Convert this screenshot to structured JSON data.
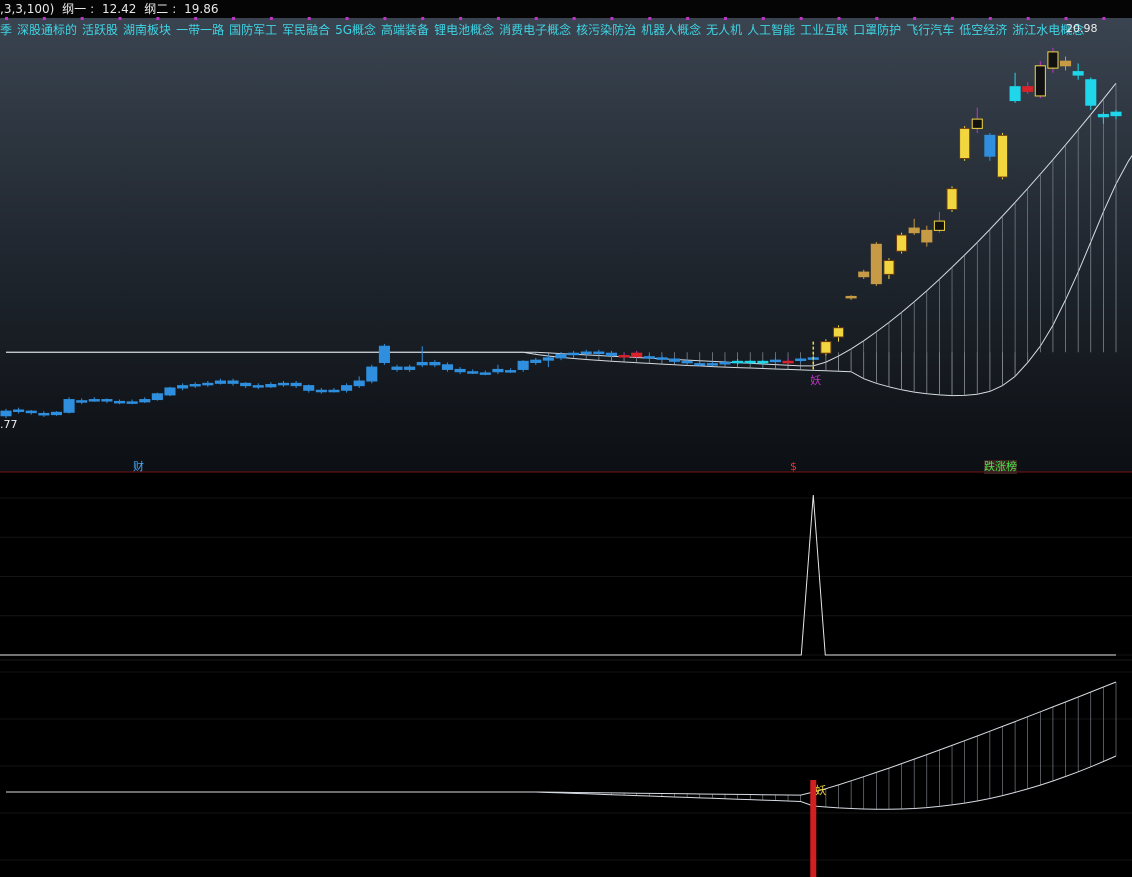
{
  "header": {
    "params": ",3,3,100)",
    "line1_label": "纲一",
    "line1_value": "12.42",
    "line2_label": "纲二",
    "line2_value": "19.86"
  },
  "concepts": [
    "季",
    "深股通标的",
    "活跃股",
    "湖南板块",
    "一带一路",
    "国防军工",
    "军民融合",
    "5G概念",
    "高端装备",
    "锂电池概念",
    "消费电子概念",
    "核污染防治",
    "机器人概念",
    "无人机",
    "人工智能",
    "工业互联",
    "口罩防护",
    "飞行汽车",
    "低空经济",
    "浙江水电概念"
  ],
  "price_labels": {
    "high": "20.98",
    "low": ".77"
  },
  "markers": {
    "cai": "财",
    "dollar": "$",
    "dzb": "跌涨榜"
  },
  "candle_marks": {
    "main_signal": "妖",
    "bottom_signal": "妖"
  },
  "colors": {
    "blue_candle": "#2f8fde",
    "yellow_candle": "#f2d640",
    "tan_candle": "#c79a45",
    "cyan_candle": "#1fd6ea",
    "magenta": "#c233c8",
    "red": "#d8232a",
    "line": "#d6dbe2",
    "signal_bar": "#d21f1f"
  },
  "chart_data": [
    {
      "type": "candlestick",
      "price_high_label": 20.98,
      "candles": [
        {
          "o": 5.1,
          "c": 5.3,
          "h": 5.4,
          "l": 5.0,
          "k": "blue"
        },
        {
          "o": 5.3,
          "c": 5.35,
          "h": 5.45,
          "l": 5.2,
          "k": "blue"
        },
        {
          "o": 5.3,
          "c": 5.25,
          "h": 5.35,
          "l": 5.15,
          "k": "blue"
        },
        {
          "o": 5.2,
          "c": 5.15,
          "h": 5.3,
          "l": 5.05,
          "k": "blue"
        },
        {
          "o": 5.15,
          "c": 5.25,
          "h": 5.3,
          "l": 5.1,
          "k": "blue"
        },
        {
          "o": 5.25,
          "c": 5.8,
          "h": 5.9,
          "l": 5.2,
          "k": "blue"
        },
        {
          "o": 5.7,
          "c": 5.75,
          "h": 5.85,
          "l": 5.6,
          "k": "blue"
        },
        {
          "o": 5.75,
          "c": 5.8,
          "h": 5.9,
          "l": 5.7,
          "k": "blue"
        },
        {
          "o": 5.8,
          "c": 5.75,
          "h": 5.85,
          "l": 5.65,
          "k": "blue"
        },
        {
          "o": 5.7,
          "c": 5.72,
          "h": 5.8,
          "l": 5.6,
          "k": "blue"
        },
        {
          "o": 5.7,
          "c": 5.7,
          "h": 5.8,
          "l": 5.6,
          "k": "blue"
        },
        {
          "o": 5.7,
          "c": 5.8,
          "h": 5.9,
          "l": 5.65,
          "k": "blue"
        },
        {
          "o": 5.8,
          "c": 6.05,
          "h": 6.1,
          "l": 5.75,
          "k": "blue"
        },
        {
          "o": 6.0,
          "c": 6.3,
          "h": 6.35,
          "l": 5.95,
          "k": "blue"
        },
        {
          "o": 6.3,
          "c": 6.4,
          "h": 6.5,
          "l": 6.2,
          "k": "blue"
        },
        {
          "o": 6.4,
          "c": 6.45,
          "h": 6.55,
          "l": 6.3,
          "k": "blue"
        },
        {
          "o": 6.45,
          "c": 6.5,
          "h": 6.6,
          "l": 6.35,
          "k": "blue"
        },
        {
          "o": 6.5,
          "c": 6.6,
          "h": 6.7,
          "l": 6.45,
          "k": "blue"
        },
        {
          "o": 6.6,
          "c": 6.5,
          "h": 6.7,
          "l": 6.4,
          "k": "blue"
        },
        {
          "o": 6.5,
          "c": 6.4,
          "h": 6.55,
          "l": 6.3,
          "k": "blue"
        },
        {
          "o": 6.4,
          "c": 6.35,
          "h": 6.5,
          "l": 6.25,
          "k": "blue"
        },
        {
          "o": 6.35,
          "c": 6.45,
          "h": 6.55,
          "l": 6.3,
          "k": "blue"
        },
        {
          "o": 6.45,
          "c": 6.5,
          "h": 6.6,
          "l": 6.35,
          "k": "blue"
        },
        {
          "o": 6.5,
          "c": 6.4,
          "h": 6.6,
          "l": 6.3,
          "k": "blue"
        },
        {
          "o": 6.4,
          "c": 6.2,
          "h": 6.45,
          "l": 6.1,
          "k": "blue"
        },
        {
          "o": 6.2,
          "c": 6.15,
          "h": 6.3,
          "l": 6.05,
          "k": "blue"
        },
        {
          "o": 6.15,
          "c": 6.2,
          "h": 6.3,
          "l": 6.1,
          "k": "blue"
        },
        {
          "o": 6.2,
          "c": 6.4,
          "h": 6.5,
          "l": 6.1,
          "k": "blue"
        },
        {
          "o": 6.4,
          "c": 6.6,
          "h": 6.8,
          "l": 6.3,
          "k": "blue"
        },
        {
          "o": 6.6,
          "c": 7.2,
          "h": 7.3,
          "l": 6.5,
          "k": "blue"
        },
        {
          "o": 7.4,
          "c": 8.1,
          "h": 8.2,
          "l": 7.3,
          "k": "blue"
        },
        {
          "o": 7.2,
          "c": 7.1,
          "h": 7.3,
          "l": 7.0,
          "k": "blue"
        },
        {
          "o": 7.1,
          "c": 7.2,
          "h": 7.3,
          "l": 7.0,
          "k": "blue"
        },
        {
          "o": 7.3,
          "c": 7.4,
          "h": 8.1,
          "l": 7.2,
          "k": "blue"
        },
        {
          "o": 7.4,
          "c": 7.3,
          "h": 7.5,
          "l": 7.2,
          "k": "blue"
        },
        {
          "o": 7.3,
          "c": 7.1,
          "h": 7.4,
          "l": 7.0,
          "k": "blue"
        },
        {
          "o": 7.1,
          "c": 7.0,
          "h": 7.2,
          "l": 6.9,
          "k": "blue"
        },
        {
          "o": 7.0,
          "c": 6.95,
          "h": 7.1,
          "l": 6.9,
          "k": "blue"
        },
        {
          "o": 6.95,
          "c": 6.9,
          "h": 7.05,
          "l": 6.85,
          "k": "blue"
        },
        {
          "o": 7.0,
          "c": 7.1,
          "h": 7.3,
          "l": 6.9,
          "k": "blue"
        },
        {
          "o": 7.05,
          "c": 7.05,
          "h": 7.15,
          "l": 6.95,
          "k": "blue"
        },
        {
          "o": 7.1,
          "c": 7.45,
          "h": 7.5,
          "l": 7.0,
          "k": "blue"
        },
        {
          "o": 7.4,
          "c": 7.5,
          "h": 7.6,
          "l": 7.3,
          "k": "blue"
        },
        {
          "o": 7.5,
          "c": 7.6,
          "h": 7.7,
          "l": 7.2,
          "k": "blue"
        },
        {
          "o": 7.6,
          "c": 7.75,
          "h": 7.85,
          "l": 7.5,
          "k": "blue"
        },
        {
          "o": 7.75,
          "c": 7.8,
          "h": 7.9,
          "l": 7.65,
          "k": "blue"
        },
        {
          "o": 7.8,
          "c": 7.85,
          "h": 7.95,
          "l": 7.7,
          "k": "blue"
        },
        {
          "o": 7.85,
          "c": 7.8,
          "h": 7.95,
          "l": 7.7,
          "k": "blue"
        },
        {
          "o": 7.8,
          "c": 7.7,
          "h": 7.9,
          "l": 7.6,
          "k": "blue"
        },
        {
          "o": 7.7,
          "c": 7.65,
          "h": 7.8,
          "l": 7.6,
          "k": "red"
        },
        {
          "o": 7.65,
          "c": 7.8,
          "h": 7.9,
          "l": 7.6,
          "k": "red"
        },
        {
          "o": 7.65,
          "c": 7.6,
          "h": 7.75,
          "l": 7.55,
          "k": "blue"
        },
        {
          "o": 7.6,
          "c": 7.55,
          "h": 7.7,
          "l": 7.5,
          "k": "blue"
        },
        {
          "o": 7.55,
          "c": 7.45,
          "h": 7.6,
          "l": 7.4,
          "k": "blue"
        },
        {
          "o": 7.45,
          "c": 7.4,
          "h": 7.55,
          "l": 7.35,
          "k": "blue"
        },
        {
          "o": 7.35,
          "c": 7.3,
          "h": 7.45,
          "l": 7.25,
          "k": "blue"
        },
        {
          "o": 7.35,
          "c": 7.35,
          "h": 7.45,
          "l": 7.25,
          "k": "blue"
        },
        {
          "o": 7.4,
          "c": 7.4,
          "h": 7.5,
          "l": 7.3,
          "k": "blue"
        },
        {
          "o": 7.4,
          "c": 7.45,
          "h": 7.55,
          "l": 7.3,
          "k": "cyan"
        },
        {
          "o": 7.45,
          "c": 7.4,
          "h": 7.5,
          "l": 7.35,
          "k": "cyan"
        },
        {
          "o": 7.4,
          "c": 7.45,
          "h": 7.5,
          "l": 7.3,
          "k": "cyan"
        },
        {
          "o": 7.45,
          "c": 7.5,
          "h": 7.6,
          "l": 7.35,
          "k": "blue"
        },
        {
          "o": 7.45,
          "c": 7.45,
          "h": 7.6,
          "l": 7.35,
          "k": "red"
        },
        {
          "o": 7.5,
          "c": 7.55,
          "h": 7.6,
          "l": 7.4,
          "k": "blue"
        },
        {
          "o": 7.55,
          "c": 7.6,
          "h": 7.65,
          "l": 7.45,
          "k": "blue"
        },
        {
          "o": 7.8,
          "c": 8.3,
          "h": 8.4,
          "l": 7.7,
          "k": "yellow"
        },
        {
          "o": 8.5,
          "c": 8.9,
          "h": 9.0,
          "l": 8.3,
          "k": "yellow"
        },
        {
          "o": 10.2,
          "c": 10.25,
          "h": 10.3,
          "l": 10.1,
          "k": "tan"
        },
        {
          "o": 11.1,
          "c": 11.3,
          "h": 11.4,
          "l": 11.0,
          "k": "tan"
        },
        {
          "o": 10.8,
          "c": 12.5,
          "h": 12.6,
          "l": 10.7,
          "k": "tan"
        },
        {
          "o": 11.2,
          "c": 11.8,
          "h": 11.9,
          "l": 11.0,
          "k": "yellow"
        },
        {
          "o": 12.2,
          "c": 12.9,
          "h": 13.0,
          "l": 12.1,
          "k": "yellow"
        },
        {
          "o": 13.0,
          "c": 13.2,
          "h": 13.6,
          "l": 12.9,
          "k": "tan"
        },
        {
          "o": 12.6,
          "c": 13.1,
          "h": 13.3,
          "l": 12.4,
          "k": "tan"
        },
        {
          "o": 13.1,
          "c": 13.5,
          "h": 13.9,
          "l": 13.0,
          "k": "black"
        },
        {
          "o": 14.0,
          "c": 14.9,
          "h": 15.0,
          "l": 13.9,
          "k": "yellow"
        },
        {
          "o": 16.2,
          "c": 17.5,
          "h": 17.6,
          "l": 16.1,
          "k": "yellow"
        },
        {
          "o": 17.5,
          "c": 17.9,
          "h": 18.4,
          "l": 17.3,
          "k": "black"
        },
        {
          "o": 17.2,
          "c": 16.3,
          "h": 17.3,
          "l": 16.1,
          "k": "blue"
        },
        {
          "o": 15.4,
          "c": 17.2,
          "h": 17.3,
          "l": 15.3,
          "k": "yellow"
        },
        {
          "o": 18.7,
          "c": 19.3,
          "h": 19.9,
          "l": 18.6,
          "k": "cyan"
        },
        {
          "o": 19.1,
          "c": 19.3,
          "h": 19.5,
          "l": 19.0,
          "k": "red"
        },
        {
          "o": 18.9,
          "c": 20.2,
          "h": 20.4,
          "l": 18.8,
          "k": "black"
        },
        {
          "o": 20.1,
          "c": 20.8,
          "h": 20.98,
          "l": 19.9,
          "k": "black"
        },
        {
          "o": 20.4,
          "c": 20.2,
          "h": 20.6,
          "l": 20.0,
          "k": "tan"
        },
        {
          "o": 19.95,
          "c": 19.8,
          "h": 20.3,
          "l": 19.6,
          "k": "cyan"
        },
        {
          "o": 19.6,
          "c": 18.5,
          "h": 19.7,
          "l": 18.3,
          "k": "cyan"
        },
        {
          "o": 18.1,
          "c": 18.0,
          "h": 18.2,
          "l": 17.7,
          "k": "cyan"
        },
        {
          "o": 18.2,
          "c": 18.05,
          "h": 18.3,
          "l": 17.9,
          "k": "cyan"
        }
      ],
      "line_one": [
        7.84,
        7.84,
        7.84,
        7.84,
        7.84,
        7.84,
        7.84,
        7.84,
        7.84,
        7.84,
        7.84,
        7.84,
        7.84,
        7.84,
        7.84,
        7.84,
        7.84,
        7.84,
        7.84,
        7.84,
        7.84,
        7.84,
        7.84,
        7.84,
        7.84,
        7.84,
        7.84,
        7.84,
        7.84,
        7.84,
        7.84,
        7.84,
        7.84,
        7.84,
        7.84,
        7.84,
        7.84,
        7.84,
        7.84,
        7.84,
        7.84,
        7.84,
        7.84,
        7.84,
        7.84,
        7.84,
        7.84,
        7.84,
        7.84,
        7.84,
        7.84,
        7.84,
        7.84,
        7.84,
        7.84,
        7.84,
        7.84,
        7.84,
        7.84,
        7.84,
        7.84,
        7.84,
        7.84,
        7.84,
        7.84,
        7.84,
        7.84,
        7.84,
        7.84,
        7.84,
        7.84,
        7.84,
        7.84,
        7.84,
        7.84,
        7.84,
        7.84,
        7.84,
        7.84,
        7.84,
        7.84,
        7.84,
        7.84,
        7.84,
        7.84,
        7.84,
        7.84,
        7.84,
        7.84,
        7.84,
        7.84,
        7.84,
        7.84
      ],
      "line_two": [
        7.84,
        7.84,
        7.84,
        7.84,
        7.84,
        7.84,
        7.84,
        7.84,
        7.84,
        7.84,
        7.84,
        7.84,
        7.84,
        7.84,
        7.84,
        7.84,
        7.84,
        7.84,
        7.84,
        7.84,
        7.84,
        7.84,
        7.84,
        7.84,
        7.84,
        7.84,
        7.84,
        7.84,
        7.84,
        7.84,
        7.84,
        7.84,
        7.84,
        7.84,
        7.84,
        7.84,
        7.84,
        7.84,
        7.84,
        7.84,
        7.84,
        7.84,
        7.75,
        7.68,
        7.62,
        7.57,
        7.53,
        7.49,
        7.45,
        7.42,
        7.39,
        7.36,
        7.33,
        7.3,
        7.27,
        7.25,
        7.22,
        7.2,
        7.18,
        7.16,
        7.14,
        7.12,
        7.1,
        7.08,
        7.06,
        7.04,
        7.02,
        7.0,
        6.7,
        6.5,
        6.35,
        6.22,
        6.12,
        6.05,
        6.0,
        5.97,
        5.98,
        6.03,
        6.15,
        6.4,
        6.8,
        7.4,
        8.1,
        9.0,
        10.1,
        11.3,
        12.6,
        13.9,
        15.1,
        16.1,
        16.9,
        17.4,
        17.7,
        17.9,
        18.1,
        18.2
      ]
    },
    {
      "type": "line",
      "panel": "middle",
      "signal_index": 64,
      "baseline": 0,
      "peak": 1
    },
    {
      "type": "area",
      "panel": "bottom",
      "signal_index": 64
    }
  ]
}
